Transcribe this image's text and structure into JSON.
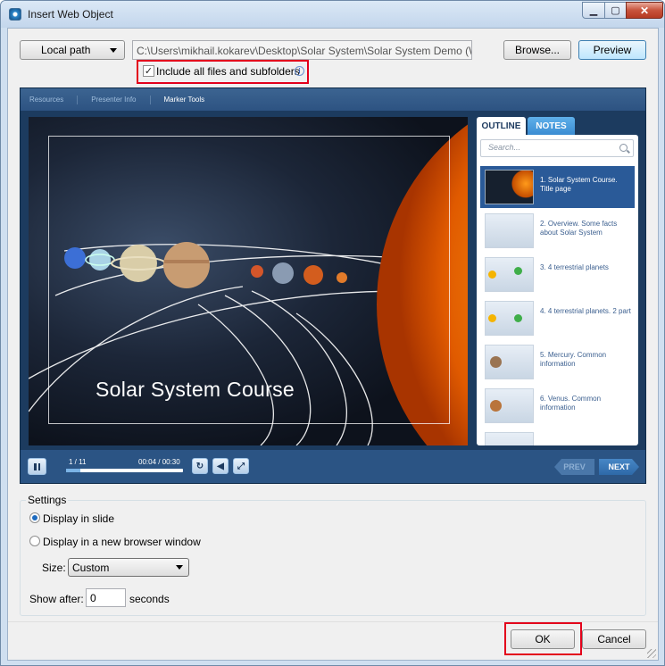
{
  "window": {
    "title": "Insert Web Object",
    "minimize": "▁",
    "maximize": "▢",
    "close": "✕"
  },
  "toolbar": {
    "source_type": "Local path",
    "path_value": "C:\\Users\\mikhail.kokarev\\Desktop\\Solar System\\Solar System Demo (Web)\\index.ht",
    "browse_label": "Browse...",
    "preview_label": "Preview",
    "include_label": "Include all files and subfolders",
    "include_checked": "✓",
    "info_glyph": "i"
  },
  "player": {
    "nav": [
      "Resources",
      "Presenter Info",
      "Marker Tools"
    ],
    "slide_title": "Solar System Course",
    "tabs": {
      "outline": "OUTLINE",
      "notes": "NOTES"
    },
    "search_placeholder": "Search...",
    "outline": [
      {
        "label": "1. Solar System Course. Title page",
        "selected": true
      },
      {
        "label": "2. Overview. Some facts about Solar System"
      },
      {
        "label": "3. 4 terrestrial planets"
      },
      {
        "label": "4. 4 terrestrial planets. 2 part"
      },
      {
        "label": "5. Mercury. Common information"
      },
      {
        "label": "6. Venus. Common information"
      }
    ],
    "controls": {
      "slide_count": "1 / 11",
      "time": "00:04 / 00:30",
      "progress": 0.12,
      "prev": "PREV",
      "next": "NEXT"
    }
  },
  "settings": {
    "legend": "Settings",
    "display_in_slide": "Display in slide",
    "display_in_window": "Display in a new browser window",
    "size_label": "Size:",
    "size_value": "Custom",
    "show_after_label": "Show after:",
    "show_after_value": "0",
    "seconds_label": "seconds"
  },
  "buttons": {
    "ok": "OK",
    "cancel": "Cancel"
  },
  "colors": {
    "highlight": "#e3001b",
    "player_bg": "#1c3b5f",
    "selected_item": "#2a5a98"
  }
}
